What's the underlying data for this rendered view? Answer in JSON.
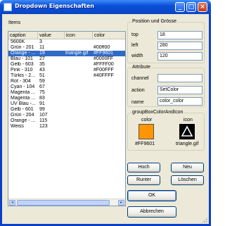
{
  "window": {
    "title": "Dropdown Eigenschaften",
    "minimize": "_",
    "maximize": "□",
    "close": "×"
  },
  "items_label": "Items",
  "listview": {
    "columns": [
      "caption",
      "value",
      "icon",
      "color"
    ],
    "rows": [
      {
        "caption": "5600K",
        "value": "3",
        "icon": "",
        "color": ""
      },
      {
        "caption": "Grün - 201",
        "value": "11",
        "icon": "",
        "color": "#00ff00"
      },
      {
        "caption": "Orange - ...",
        "value": "19",
        "icon": "triangle.gif",
        "color": "#FF9601",
        "selected": true
      },
      {
        "caption": "Blau - 101",
        "value": "27",
        "icon": "",
        "color": "#0000FF"
      },
      {
        "caption": "Gelb - 603",
        "value": "35",
        "icon": "",
        "color": "#FFFF00"
      },
      {
        "caption": "Pink - 310",
        "value": "43",
        "icon": "",
        "color": "#F00FFF"
      },
      {
        "caption": "Türkis - 2...",
        "value": "51",
        "icon": "",
        "color": "#40FFFF"
      },
      {
        "caption": "Rot - 304",
        "value": "59",
        "icon": "",
        "color": ""
      },
      {
        "caption": "Cyan - 104",
        "value": "67",
        "icon": "",
        "color": ""
      },
      {
        "caption": "Magenta ...",
        "value": "75",
        "icon": "",
        "color": ""
      },
      {
        "caption": "Magenta ...",
        "value": "83",
        "icon": "",
        "color": ""
      },
      {
        "caption": "UV Blau -...",
        "value": "91",
        "icon": "",
        "color": ""
      },
      {
        "caption": "Gelb - 601",
        "value": "99",
        "icon": "",
        "color": ""
      },
      {
        "caption": "Grün - 204",
        "value": "107",
        "icon": "",
        "color": ""
      },
      {
        "caption": "Orange - ...",
        "value": "115",
        "icon": "",
        "color": ""
      },
      {
        "caption": "Weiss",
        "value": "123",
        "icon": "",
        "color": ""
      }
    ],
    "scroll_left": "◂",
    "scroll_right": "▸"
  },
  "position_group": {
    "title": "Position und Grösse",
    "top_label": "top",
    "top_value": "18",
    "left_label": "left",
    "left_value": "280",
    "width_label": "width",
    "width_value": "120"
  },
  "attribute_group": {
    "title": "Attribute",
    "channel_label": "channel",
    "channel_value": "",
    "action_label": "action",
    "action_value": "SetColor",
    "name_label": "name",
    "name_value": "color_color"
  },
  "color_icon_group": {
    "title": "groupBoxColorAndIcon",
    "color_label": "color",
    "icon_label": "icon",
    "color_value": "#FF9601",
    "icon_value": "triangle.gif",
    "swatch_color": "#ff9601",
    "icon_name": "triangle-icon"
  },
  "buttons": {
    "hoch": "Hoch",
    "neu": "Neu",
    "runter": "Runter",
    "loeschen": "Löschen",
    "ok": "OK",
    "abbrechen": "Abbrechen"
  },
  "colors": {
    "titlebar": "#0a50d8",
    "dialog_bg": "#ece9d8",
    "selection": "#316ac5"
  }
}
